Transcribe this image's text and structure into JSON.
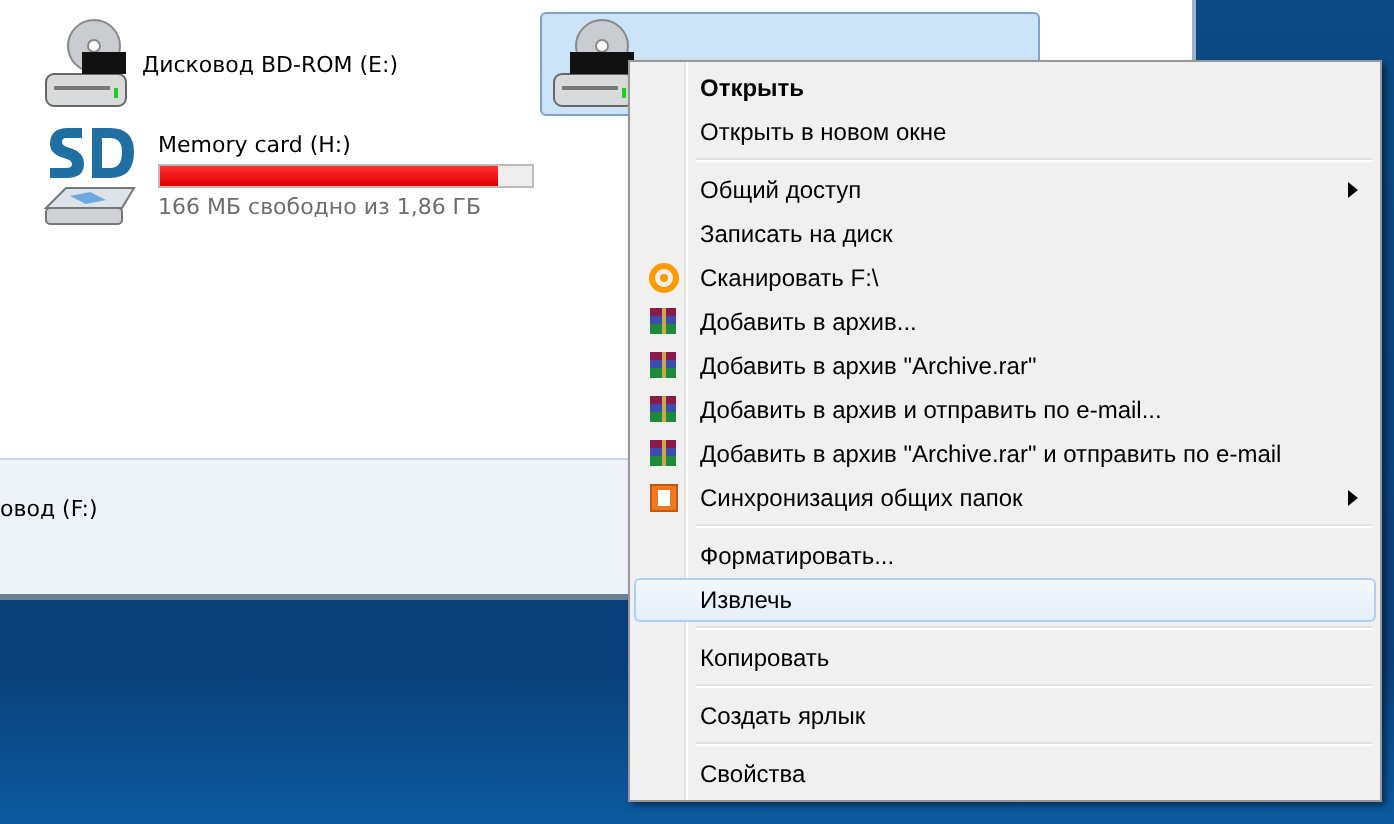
{
  "drives": [
    {
      "kind": "bd",
      "name": "Дисковод BD-ROM (E:)",
      "selected": false
    },
    {
      "kind": "sd",
      "name": "Memory card (H:)",
      "level": 0.91,
      "free": "166 МБ свободно из 1,86 ГБ",
      "selected": false
    },
    {
      "kind": "dvd",
      "selected": true
    }
  ],
  "details": {
    "name": "овод (F:)"
  },
  "menu": [
    {
      "kind": "item",
      "label": "Открыть",
      "bold": true,
      "submenu": false,
      "selected": false
    },
    {
      "kind": "item",
      "label": "Открыть в новом окне",
      "bold": false,
      "submenu": false,
      "selected": false
    },
    {
      "kind": "separator"
    },
    {
      "kind": "item",
      "label": "Общий доступ",
      "bold": false,
      "submenu": true,
      "selected": false
    },
    {
      "kind": "item",
      "label": "Записать на диск",
      "bold": false,
      "submenu": false,
      "selected": false
    },
    {
      "kind": "scan",
      "label": "Сканировать F:\\",
      "bold": false,
      "submenu": false,
      "selected": false
    },
    {
      "kind": "archive",
      "label": "Добавить в архив...",
      "bold": false,
      "submenu": false,
      "selected": false
    },
    {
      "kind": "archive",
      "label": "Добавить в архив \"Archive.rar\"",
      "bold": false,
      "submenu": false,
      "selected": false
    },
    {
      "kind": "archive",
      "label": "Добавить в архив и отправить по e-mail...",
      "bold": false,
      "submenu": false,
      "selected": false
    },
    {
      "kind": "archive",
      "label": "Добавить в архив \"Archive.rar\" и отправить по e-mail",
      "bold": false,
      "submenu": false,
      "selected": false
    },
    {
      "kind": "sync",
      "label": "Синхронизация общих папок",
      "bold": false,
      "submenu": true,
      "selected": false
    },
    {
      "kind": "separator"
    },
    {
      "kind": "item",
      "label": "Форматировать...",
      "bold": false,
      "submenu": false,
      "selected": false
    },
    {
      "kind": "item",
      "label": "Извлечь",
      "bold": false,
      "submenu": false,
      "selected": true
    },
    {
      "kind": "separator"
    },
    {
      "kind": "item",
      "label": "Копировать",
      "bold": false,
      "submenu": false,
      "selected": false
    },
    {
      "kind": "separator"
    },
    {
      "kind": "item",
      "label": "Создать ярлык",
      "bold": false,
      "submenu": false,
      "selected": false
    },
    {
      "kind": "separator"
    },
    {
      "kind": "item",
      "label": "Свойства",
      "bold": false,
      "submenu": false,
      "selected": false
    }
  ]
}
